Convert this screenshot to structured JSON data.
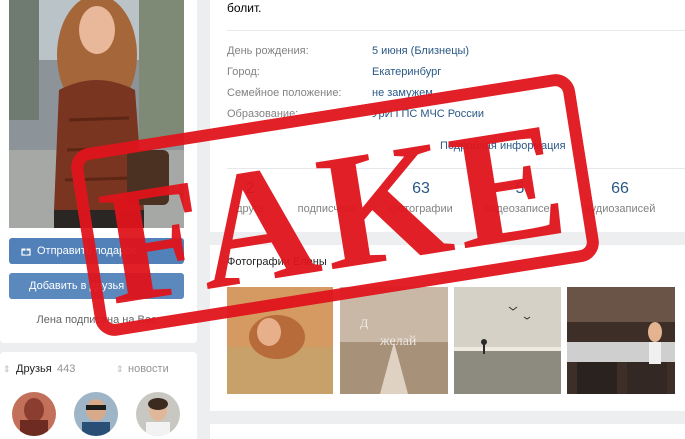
{
  "left": {
    "send_button_label": "Отправить подарок",
    "add_button_label": "Добавить в друзья",
    "subscribed_text": "Лена подписана на Вас"
  },
  "friends": {
    "title": "Друзья",
    "count": "443",
    "news_link": "новости"
  },
  "profile": {
    "status_text": "болит.",
    "info_rows": [
      {
        "label": "День рождения:",
        "value": "5 июня (Близнецы)"
      },
      {
        "label": "Город:",
        "value": "Екатеринбург"
      },
      {
        "label": "Семейное положение:",
        "value": "не замужем"
      },
      {
        "label": "Образование:",
        "value": "УрИ ГПС МЧС России"
      }
    ],
    "more_info": "Подробная информация",
    "counters": [
      {
        "num": "2",
        "label": "друга"
      },
      {
        "num": "",
        "label": "подписчика"
      },
      {
        "num": "63",
        "label": "фотографии"
      },
      {
        "num": "5",
        "label": "видеозаписей"
      },
      {
        "num": "66",
        "label": "аудиозаписей"
      }
    ]
  },
  "photos": {
    "title": "Фотографии Елены"
  },
  "stamp": {
    "text": "FAKE",
    "color": "#e0141c"
  },
  "colors": {
    "link": "#2a5885",
    "button": "#5181b8",
    "background": "#edeef0"
  }
}
